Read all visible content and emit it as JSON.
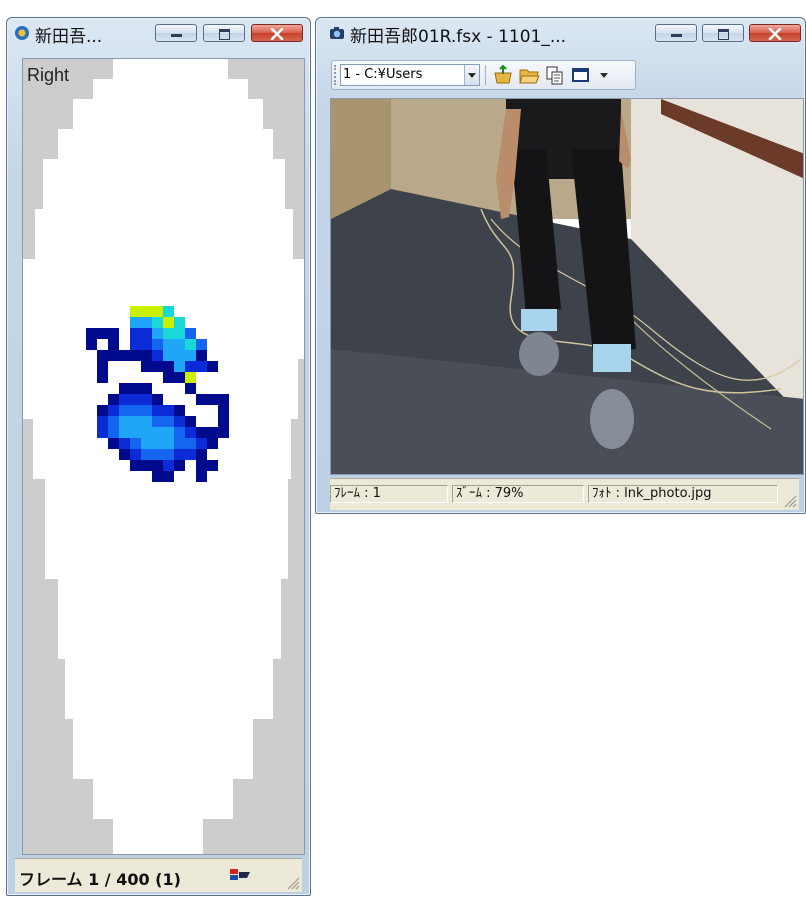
{
  "colors": {
    "accent": "#3c78c8",
    "close": "#c7402b",
    "pressure_max": "#c8f000"
  },
  "left_window": {
    "title": "新田吾...",
    "icon": "app-flower-icon",
    "side_label": "Right",
    "status": {
      "frame_text": "フレーム 1 / 400 (1)"
    },
    "controls": [
      "minimize-icon",
      "maximize-icon",
      "close-icon"
    ]
  },
  "right_window": {
    "title": "新田吾郎01R.fsx - 1101_...",
    "icon": "camera-icon",
    "toolbar": {
      "combo_value": "1 - C:¥Users",
      "buttons": [
        "import-icon",
        "open-folder-icon",
        "copy-icon",
        "frame-icon"
      ]
    },
    "status": {
      "frame": "ﾌﾚｰﾑ : 1",
      "zoom": "ｽﾞｰﾑ : 79%",
      "photo": "ﾌｫﾄ : lnk_photo.jpg"
    },
    "controls": [
      "minimize-icon",
      "maximize-icon",
      "close-icon"
    ]
  }
}
